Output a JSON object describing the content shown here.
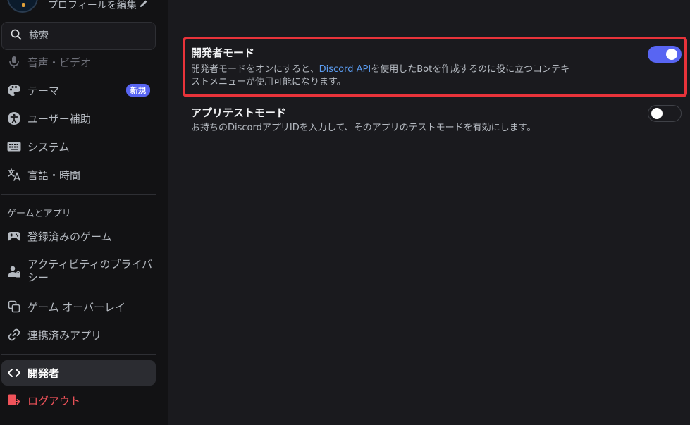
{
  "sidebar": {
    "profile_edit_label": "プロフィールを編集",
    "search_placeholder": "検索",
    "items": {
      "voice": "音声・ビデオ",
      "theme": "テーマ",
      "theme_badge": "新規",
      "accessibility": "ユーザー補助",
      "system": "システム",
      "language": "言語・時間",
      "games_section": "ゲームとアプリ",
      "registered_games": "登録済みのゲーム",
      "activity_privacy": "アクティビティのプライバシー",
      "game_overlay": "ゲーム オーバーレイ",
      "connected_apps": "連携済みアプリ",
      "developer": "開発者",
      "logout": "ログアウト"
    }
  },
  "settings": {
    "developer_mode": {
      "title": "開発者モード",
      "desc_before": "開発者モードをオンにすると、",
      "desc_link": "Discord API",
      "desc_after_line1": "を使用したBotを作成するのに役に立つコンテキ",
      "desc_line2": "ストメニューが使用可能になります。",
      "enabled": true
    },
    "app_test_mode": {
      "title": "アプリテストモード",
      "desc": "お持ちのDiscordアプリIDを入力して、そのアプリのテストモードを有効にします。",
      "enabled": false
    }
  },
  "colors": {
    "accent": "#5865f2",
    "highlight": "#e8333a",
    "logout": "#f0535a",
    "link": "#5b9cf0"
  }
}
